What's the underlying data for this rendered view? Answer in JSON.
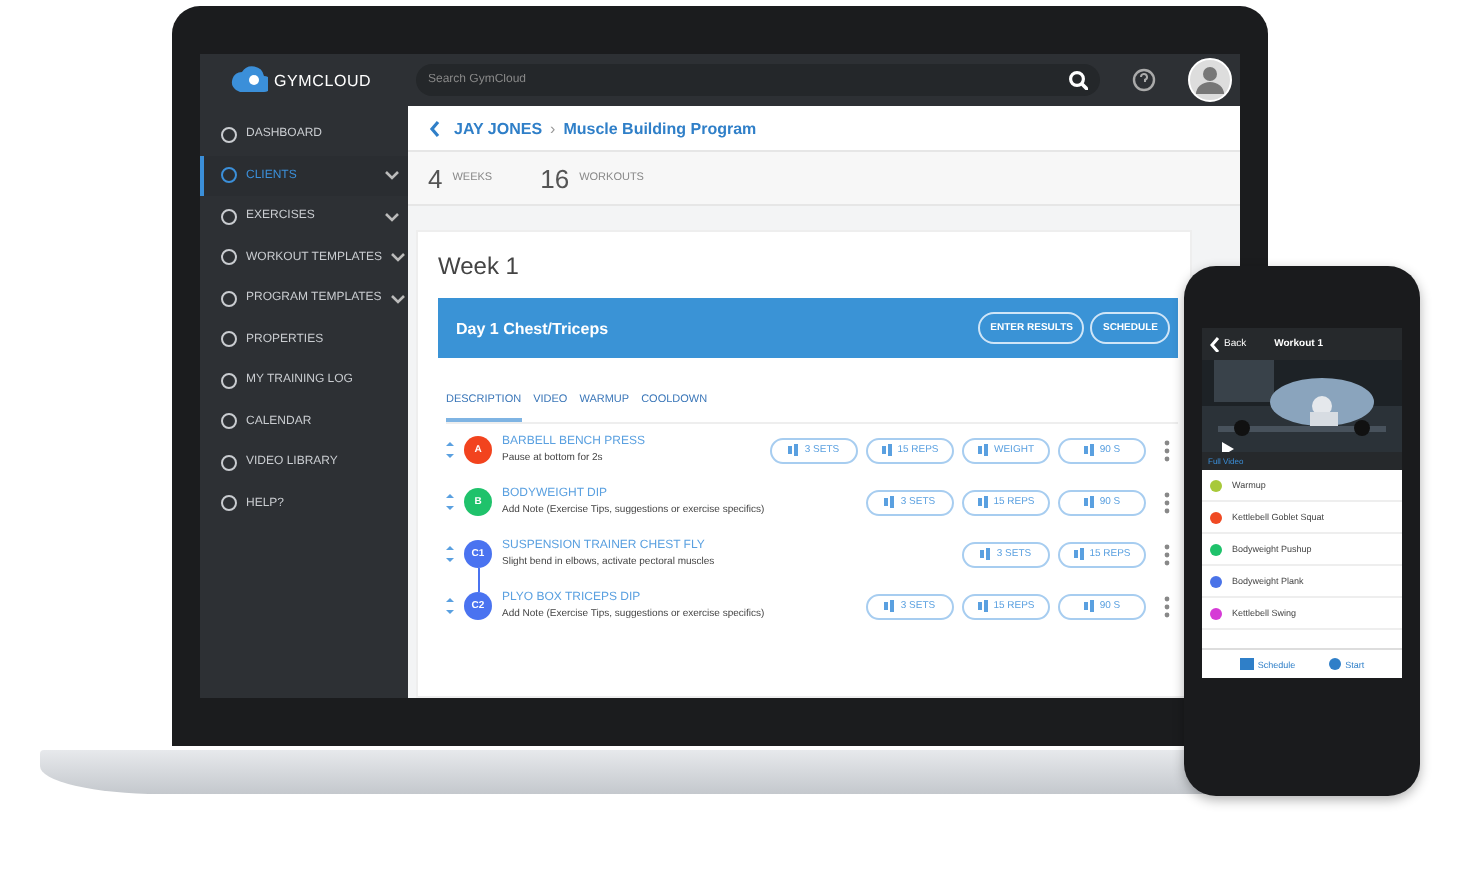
{
  "app": {
    "logo": "GYMCLOUD",
    "search": {
      "placeholder": "Search GymCloud"
    }
  },
  "sidebar": {
    "items": [
      {
        "label": "DASHBOARD",
        "selected": false,
        "has_submenu": false
      },
      {
        "label": "CLIENTS",
        "selected": true,
        "has_submenu": true
      },
      {
        "label": "EXERCISES",
        "selected": false,
        "has_submenu": true
      },
      {
        "label": "WORKOUT TEMPLATES",
        "selected": false,
        "has_submenu": true
      },
      {
        "label": "PROGRAM TEMPLATES",
        "selected": false,
        "has_submenu": true
      },
      {
        "label": "PROPERTIES",
        "selected": false,
        "has_submenu": false
      },
      {
        "label": "MY TRAINING LOG",
        "selected": false,
        "has_submenu": false
      },
      {
        "label": "CALENDAR",
        "selected": false,
        "has_submenu": false
      },
      {
        "label": "VIDEO LIBRARY",
        "selected": false,
        "has_submenu": false
      },
      {
        "label": "HELP?",
        "selected": false,
        "has_submenu": false
      }
    ]
  },
  "breadcrumb": {
    "client": "JAY JONES",
    "separator": "›",
    "program": "Muscle Building Program"
  },
  "stats": [
    {
      "value": "4",
      "label": "WEEKS"
    },
    {
      "value": "16",
      "label": "WORKOUTS"
    }
  ],
  "week": {
    "title": "Week 1",
    "day": {
      "title": "Day 1 Chest/Triceps",
      "buttons": [
        "ENTER RESULTS",
        "SCHEDULE"
      ],
      "tabs": [
        {
          "label": "DESCRIPTION",
          "selected": true
        },
        {
          "label": "VIDEO",
          "selected": false
        },
        {
          "label": "WARMUP",
          "selected": false
        },
        {
          "label": "COOLDOWN",
          "selected": false
        }
      ],
      "exercises": [
        {
          "badge": "A",
          "color": "#f2431e",
          "name": "BARBELL BENCH PRESS",
          "note": "Pause at bottom for 2s",
          "linked": false,
          "params": [
            "3 SETS",
            "15 REPS",
            "WEIGHT",
            "90 S"
          ]
        },
        {
          "badge": "B",
          "color": "#1fc26b",
          "name": "BODYWEIGHT DIP",
          "note": "Add Note (Exercise Tips, suggestions or exercise specifics)",
          "linked": false,
          "params": [
            "3 SETS",
            "15 REPS",
            "90 S"
          ]
        },
        {
          "badge": "C1",
          "color": "#4a73f0",
          "name": "SUSPENSION TRAINER CHEST FLY",
          "note": "Slight bend in elbows, activate pectoral muscles",
          "linked": true,
          "params": [
            "3 SETS",
            "15 REPS"
          ]
        },
        {
          "badge": "C2",
          "color": "#4a73f0",
          "name": "PLYO BOX TRICEPS DIP",
          "note": "Add Note (Exercise Tips, suggestions or exercise specifics)",
          "linked": false,
          "params": [
            "3 SETS",
            "15 REPS",
            "90 S"
          ]
        }
      ]
    }
  },
  "phone": {
    "back": "Back",
    "title": "Workout 1",
    "video_link": "Full Video",
    "items": [
      {
        "name": "Warmup",
        "color": "#a8c93a"
      },
      {
        "name": "Kettlebell Goblet Squat",
        "color": "#f04a23"
      },
      {
        "name": "Bodyweight Pushup",
        "color": "#1fc26b"
      },
      {
        "name": "Bodyweight Plank",
        "color": "#4a73e8"
      },
      {
        "name": "Kettlebell Swing",
        "color": "#d63bd6"
      }
    ],
    "tabs": [
      "Schedule",
      "Start"
    ]
  }
}
